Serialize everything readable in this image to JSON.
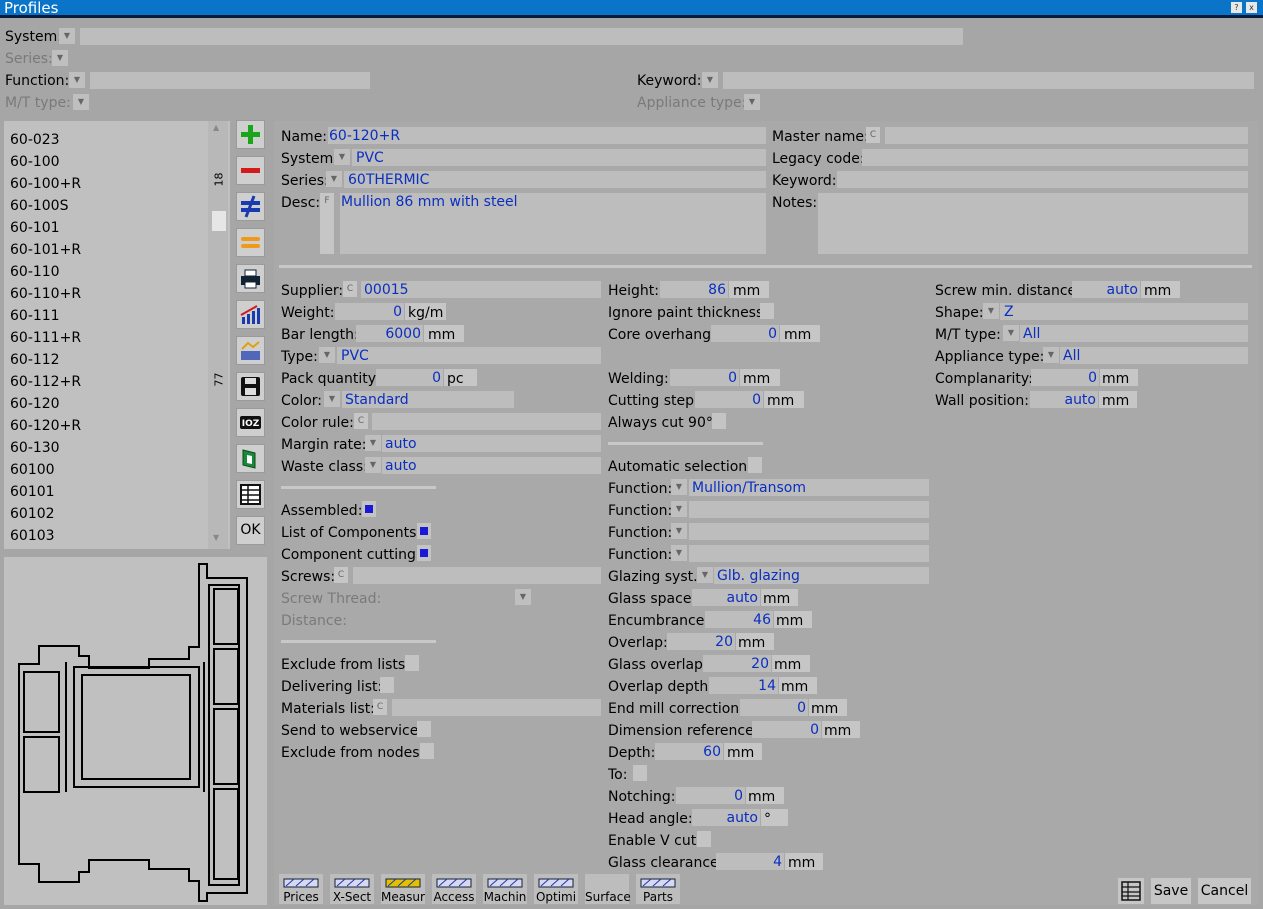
{
  "window": {
    "title": "Profiles",
    "help": "?",
    "close": "x"
  },
  "filters": {
    "system": "System:",
    "series": "Series:",
    "function": "Function:",
    "mt_type": "M/T type:",
    "keyword": "Keyword:",
    "appliance_type": "Appliance type:"
  },
  "list": {
    "items": [
      "60-023",
      "60-100",
      "60-100+R",
      "60-100S",
      "60-101",
      "60-101+R",
      "60-110",
      "60-110+R",
      "60-111",
      "60-111+R",
      "60-112",
      "60-112+R",
      "60-120",
      "60-120+R",
      "60-130",
      "60100",
      "60101",
      "60102",
      "60103"
    ],
    "count_top": "18",
    "count_bottom": "77"
  },
  "toolbar": {
    "ok": "OK",
    "icons": [
      "add-icon",
      "remove-icon",
      "not-equal-icon",
      "equal-icon",
      "print-icon",
      "chart-icon",
      "compare-icon",
      "save-icon",
      "ioz-icon",
      "profile-icon",
      "table-icon"
    ],
    "ioz": "IOZ"
  },
  "header": {
    "name_label": "Name:",
    "name": "60-120+R",
    "system_label": "System:",
    "system": "PVC",
    "series_label": "Series:",
    "series": "60THERMIC",
    "desc_label": "Desc:",
    "desc": "Mullion 86 mm with steel",
    "master_label": "Master name:",
    "legacy_label": "Legacy code:",
    "keyword_label": "Keyword:",
    "notes_label": "Notes:"
  },
  "col1": {
    "supplier_label": "Supplier:",
    "supplier": "00015",
    "weight_label": "Weight:",
    "weight": "0",
    "weight_unit": "kg/m",
    "bar_length_label": "Bar length:",
    "bar_length": "6000",
    "bar_length_unit": "mm",
    "type_label": "Type:",
    "type": "PVC",
    "pack_label": "Pack quantity:",
    "pack": "0",
    "pack_unit": "pc",
    "color_label": "Color:",
    "color": "Standard",
    "color_rule_label": "Color rule:",
    "margin_label": "Margin rate:",
    "margin": "auto",
    "waste_label": "Waste class:",
    "waste": "auto",
    "assembled_label": "Assembled:",
    "list_components_label": "List of Components:",
    "component_cutting_label": "Component cutting:",
    "screws_label": "Screws:",
    "screw_thread_label": "Screw Thread:",
    "distance_label": "Distance:",
    "exclude_lists_label": "Exclude from lists:",
    "delivering_label": "Delivering list:",
    "materials_label": "Materials list:",
    "webservice_label": "Send to webservice:",
    "exclude_nodes_label": "Exclude from nodes:"
  },
  "col2": {
    "height_label": "Height:",
    "height": "86",
    "height_unit": "mm",
    "ignore_paint_label": "Ignore paint thickness:",
    "core_label": "Core overhang:",
    "core": "0",
    "core_unit": "mm",
    "welding_label": "Welding:",
    "welding": "0",
    "welding_unit": "mm",
    "cutting_step_label": "Cutting step:",
    "cutting_step": "0",
    "cutting_step_unit": "mm",
    "always_cut_label": "Always cut 90°:",
    "auto_sel_label": "Automatic selection:",
    "function_label": "Function:",
    "function1": "Mullion/Transom",
    "glazing_label": "Glazing syst.:",
    "glazing": "Glb. glazing",
    "glass_space_label": "Glass space:",
    "glass_space": "auto",
    "glass_space_unit": "mm",
    "encumbrance_label": "Encumbrance:",
    "encumbrance": "46",
    "encumbrance_unit": "mm",
    "overlap_label": "Overlap:",
    "overlap": "20",
    "overlap_unit": "mm",
    "glass_overlap_label": "Glass overlap:",
    "glass_overlap": "20",
    "glass_overlap_unit": "mm",
    "overlap_depth_label": "Overlap depth:",
    "overlap_depth": "14",
    "overlap_depth_unit": "mm",
    "end_mill_label": "End mill correction:",
    "end_mill": "0",
    "end_mill_unit": "mm",
    "dim_ref_label": "Dimension reference:",
    "dim_ref": "0",
    "dim_ref_unit": "mm",
    "depth_label": "Depth:",
    "depth": "60",
    "depth_unit": "mm",
    "to_label": "To:",
    "notching_label": "Notching:",
    "notching": "0",
    "notching_unit": "mm",
    "head_angle_label": "Head angle:",
    "head_angle": "auto",
    "head_angle_unit": "°",
    "v_cut_label": "Enable V cut:",
    "glass_clear_label": "Glass clearance:",
    "glass_clear": "4",
    "glass_clear_unit": "mm"
  },
  "col3": {
    "screw_min_label": "Screw min. distance:",
    "screw_min": "auto",
    "screw_min_unit": "mm",
    "shape_label": "Shape:",
    "shape": "Z",
    "mt_label": "M/T type:",
    "mt": "All",
    "appliance_label": "Appliance type:",
    "appliance": "All",
    "complanarity_label": "Complanarity:",
    "complanarity": "0",
    "complanarity_unit": "mm",
    "wall_label": "Wall position:",
    "wall": "auto",
    "wall_unit": "mm"
  },
  "bottom": {
    "tabs": [
      "Prices",
      "X-Sect",
      "Measur",
      "Access",
      "Machin",
      "Optimi",
      "Surface",
      "Parts"
    ],
    "save": "Save",
    "cancel": "Cancel"
  },
  "c_glyph": "C",
  "f_glyph": "F",
  "arrow_up": "▲",
  "arrow_down": "▼"
}
